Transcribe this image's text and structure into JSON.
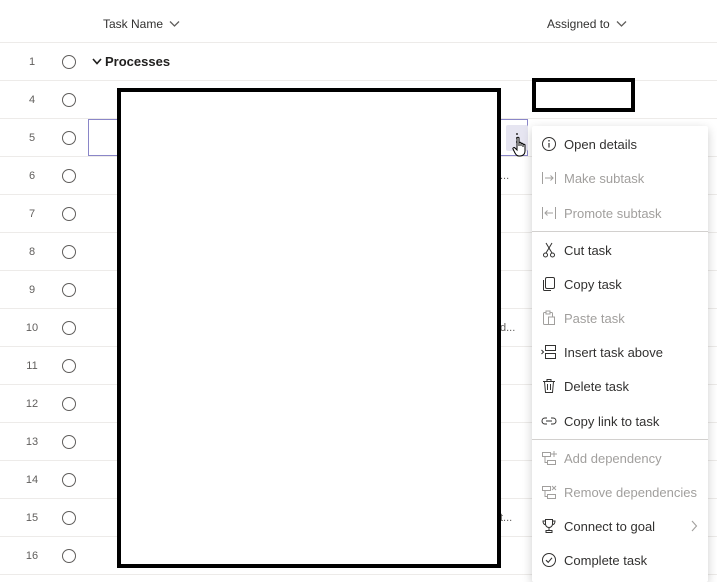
{
  "header": {
    "task_name": "Task Name",
    "assigned_to": "Assigned to"
  },
  "rows": [
    {
      "num": "1",
      "group": "Processes"
    },
    {
      "num": "4"
    },
    {
      "num": "5"
    },
    {
      "num": "6",
      "ellipsis": "..."
    },
    {
      "num": "7"
    },
    {
      "num": "8"
    },
    {
      "num": "9"
    },
    {
      "num": "10",
      "ellipsis": "d..."
    },
    {
      "num": "11"
    },
    {
      "num": "12"
    },
    {
      "num": "13"
    },
    {
      "num": "14"
    },
    {
      "num": "15",
      "ellipsis": "t..."
    },
    {
      "num": "16"
    }
  ],
  "menu": {
    "items": [
      {
        "label": "Open details",
        "icon": "info-icon",
        "disabled": false
      },
      {
        "label": "Make subtask",
        "icon": "indent-icon",
        "disabled": true
      },
      {
        "label": "Promote subtask",
        "icon": "outdent-icon",
        "disabled": true
      },
      {
        "label": "Cut task",
        "icon": "scissors-icon",
        "disabled": false
      },
      {
        "label": "Copy task",
        "icon": "copy-icon",
        "disabled": false
      },
      {
        "label": "Paste task",
        "icon": "paste-icon",
        "disabled": true
      },
      {
        "label": "Insert task above",
        "icon": "insert-above-icon",
        "disabled": false
      },
      {
        "label": "Delete task",
        "icon": "trash-icon",
        "disabled": false
      },
      {
        "label": "Copy link to task",
        "icon": "link-icon",
        "disabled": false
      },
      {
        "label": "Add dependency",
        "icon": "add-dependency-icon",
        "disabled": true
      },
      {
        "label": "Remove dependencies",
        "icon": "remove-dependency-icon",
        "disabled": true
      },
      {
        "label": "Connect to goal",
        "icon": "trophy-icon",
        "disabled": false,
        "submenu": true
      },
      {
        "label": "Complete task",
        "icon": "check-circle-icon",
        "disabled": false
      }
    ]
  },
  "colors": {
    "accent": "#8a86c8",
    "disabled_text": "#a19f9d",
    "text": "#323130",
    "row_border": "#edebe9"
  }
}
